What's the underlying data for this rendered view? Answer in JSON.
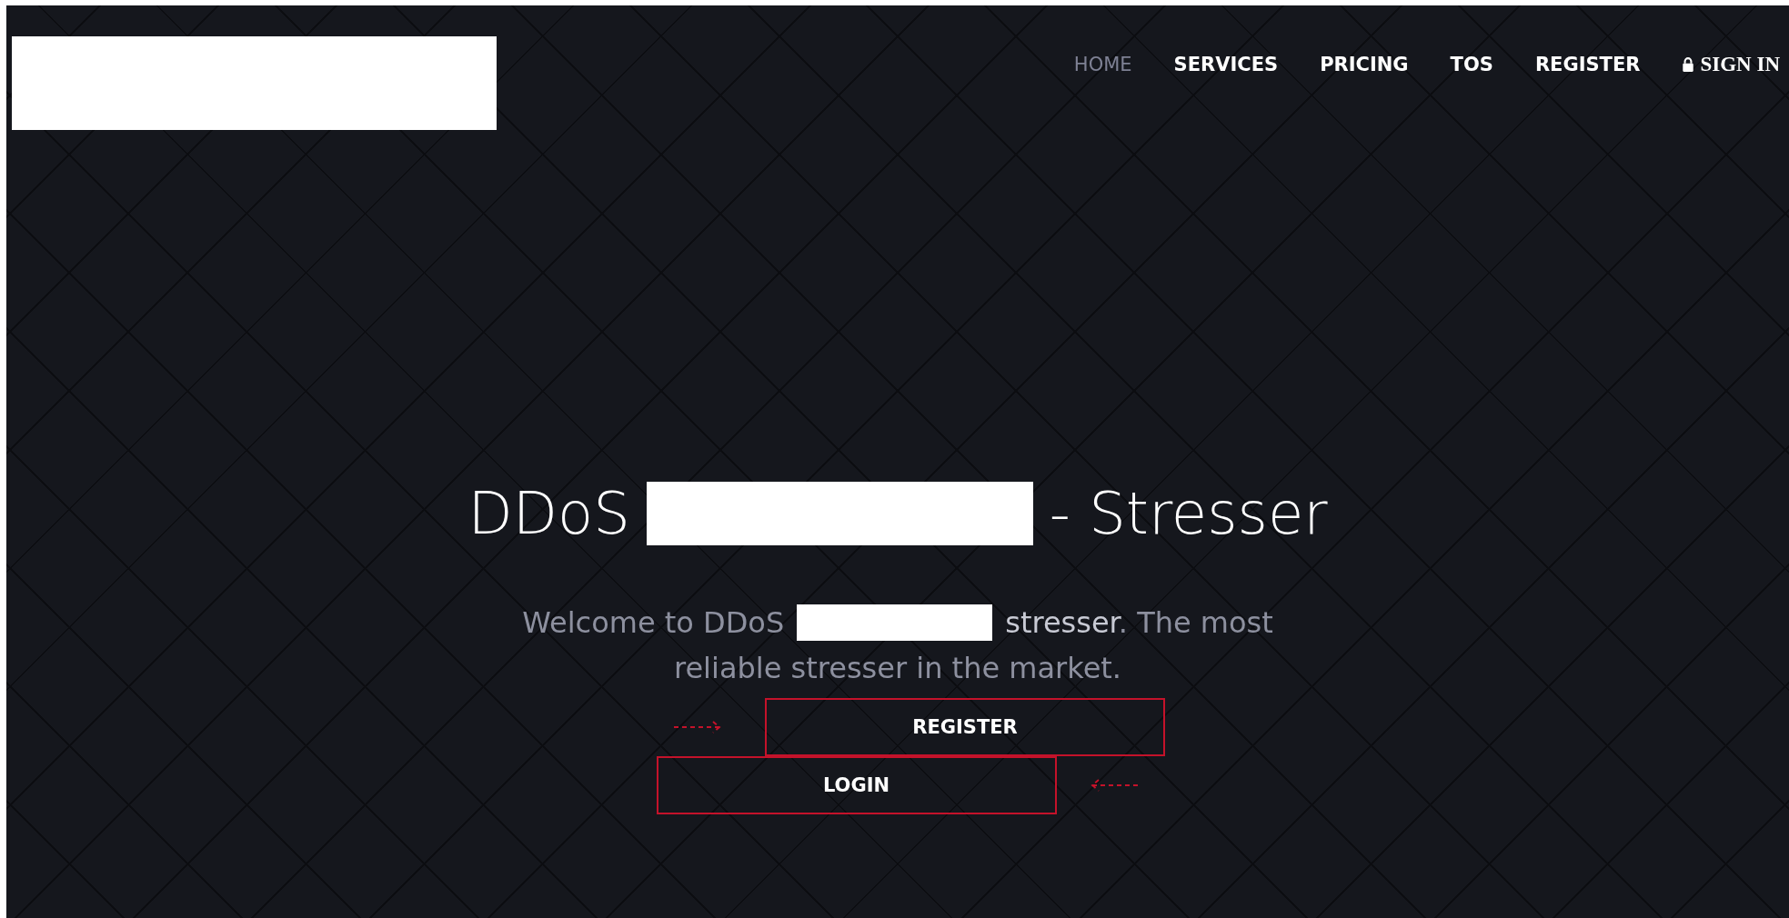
{
  "nav": {
    "items": [
      {
        "label": "HOME",
        "selected": true,
        "kind": "link"
      },
      {
        "label": "SERVICES",
        "selected": false,
        "kind": "link"
      },
      {
        "label": "PRICING",
        "selected": false,
        "kind": "link"
      },
      {
        "label": "TOS",
        "selected": false,
        "kind": "link"
      },
      {
        "label": "REGISTER",
        "selected": false,
        "kind": "link"
      },
      {
        "label": "SIGN IN",
        "selected": false,
        "kind": "lock"
      }
    ]
  },
  "hero": {
    "title_before": "DDoS",
    "title_after": "- Stresser",
    "welcome_before": "Welcome to DDoS",
    "welcome_after": "stresser. The most",
    "welcome_line2": "reliable stresser in the market.",
    "buttons": [
      "REGISTER",
      "LOGIN"
    ]
  }
}
